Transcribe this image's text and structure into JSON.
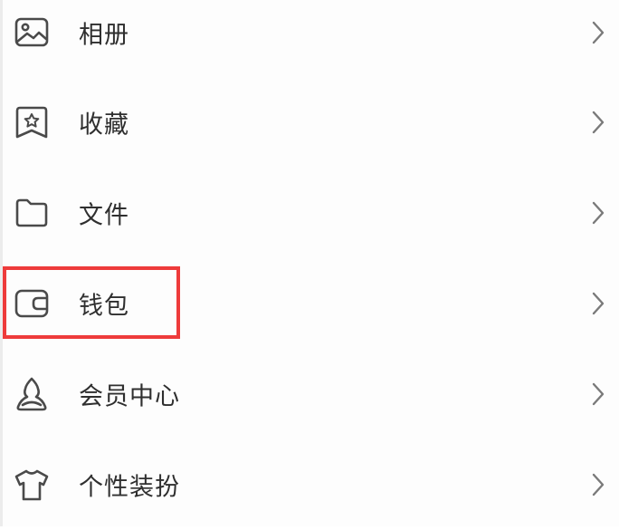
{
  "menu": {
    "items": [
      {
        "label": "相册",
        "icon": "album-icon"
      },
      {
        "label": "收藏",
        "icon": "favorites-icon"
      },
      {
        "label": "文件",
        "icon": "folder-icon"
      },
      {
        "label": "钱包",
        "icon": "wallet-icon"
      },
      {
        "label": "会员中心",
        "icon": "member-center-icon"
      },
      {
        "label": "个性装扮",
        "icon": "tshirt-icon"
      }
    ]
  },
  "colors": {
    "icon_stroke": "#4a4a4a",
    "label_text": "#2f2f2f",
    "chevron": "#7a7a7a",
    "highlight": "#ee3b3b"
  }
}
